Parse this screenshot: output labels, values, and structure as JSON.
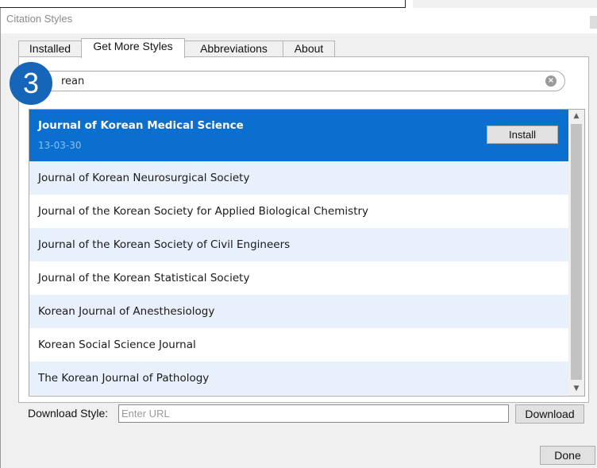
{
  "window": {
    "title": "Citation Styles"
  },
  "tabs": [
    {
      "label": "Installed",
      "active": false
    },
    {
      "label": "Get More Styles",
      "active": true
    },
    {
      "label": "Abbreviations",
      "active": false
    },
    {
      "label": "About",
      "active": false
    }
  ],
  "search": {
    "value": "rean"
  },
  "step_badge": "3",
  "styles": {
    "selected": {
      "name": "Journal of Korean Medical Science",
      "date": "13-03-30",
      "install_label": "Install"
    },
    "items": [
      "Journal of Korean Neurosurgical Society",
      "Journal of the Korean Society for Applied Biological Chemistry",
      "Journal of the Korean Society of Civil Engineers",
      "Journal of the Korean Statistical Society",
      "Korean Journal of Anesthesiology",
      "Korean Social Science Journal",
      "The Korean Journal of Pathology"
    ]
  },
  "download": {
    "label": "Download Style:",
    "placeholder": "Enter URL",
    "button_label": "Download"
  },
  "footer": {
    "done_label": "Done"
  },
  "colors": {
    "selection": "#0a6fce",
    "alt_row": "#e8f0fb",
    "badge": "#1565b8"
  }
}
